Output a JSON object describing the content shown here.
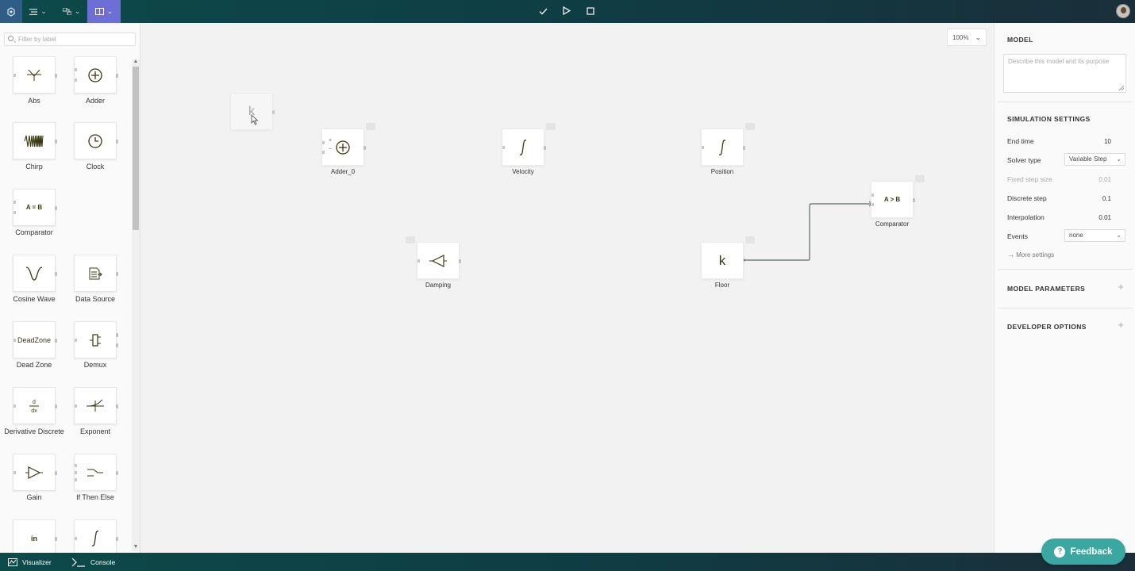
{
  "topbar": {
    "icons": [
      "logo-icon",
      "menu-icon",
      "model-icon",
      "book-icon",
      "check-icon",
      "play-icon",
      "stop-icon"
    ]
  },
  "palette": {
    "filter_placeholder": "Filter by label",
    "blocks": [
      {
        "label": "Abs",
        "glyph": "⋎"
      },
      {
        "label": "Adder",
        "glyph": "⊕"
      },
      {
        "label": "Chirp",
        "glyph": "WWW"
      },
      {
        "label": "Clock",
        "glyph": "◷"
      },
      {
        "label": "Comparator",
        "glyph": "A = B"
      },
      {
        "label": "Cosine Wave",
        "glyph": "∨"
      },
      {
        "label": "Data Source",
        "glyph": "▤"
      },
      {
        "label": "Dead Zone",
        "glyph": "DeadZone"
      },
      {
        "label": "Demux",
        "glyph": "⫷"
      },
      {
        "label": "Derivative Discrete",
        "glyph": "d/dx"
      },
      {
        "label": "Exponent",
        "glyph": "⊥"
      },
      {
        "label": "Gain",
        "glyph": "▷"
      },
      {
        "label": "If Then Else",
        "glyph": "⊶"
      },
      {
        "label": "",
        "glyph": "in"
      },
      {
        "label": "",
        "glyph": "∫"
      }
    ]
  },
  "canvas": {
    "zoom": "100%",
    "drag_glyph": "k",
    "nodes": [
      {
        "id": "adder0",
        "label": "Adder_0",
        "glyph": "⊕"
      },
      {
        "id": "velocity",
        "label": "Velocity",
        "glyph": "∫"
      },
      {
        "id": "position",
        "label": "Position",
        "glyph": "∫"
      },
      {
        "id": "comparator",
        "label": "Comparator",
        "glyph": "A > B"
      },
      {
        "id": "damping",
        "label": "Damping",
        "glyph": "◁"
      },
      {
        "id": "floor",
        "label": "Floor",
        "glyph": "k"
      }
    ],
    "adder_signs": [
      "+",
      "−"
    ]
  },
  "right_panel": {
    "model_title": "MODEL",
    "description_placeholder": "Describe this model and its purpose",
    "sim_title": "SIMULATION SETTINGS",
    "end_time_label": "End time",
    "end_time_value": "10",
    "solver_type_label": "Solver type",
    "solver_type_value": "Variable Step",
    "fixed_step_label": "Fixed step size",
    "fixed_step_value": "0.01",
    "discrete_step_label": "Discrete step",
    "discrete_step_value": "0.1",
    "interpolation_label": "Interpolation",
    "interpolation_value": "0.01",
    "events_label": "Events",
    "events_value": "none",
    "more_settings": "More settings",
    "model_params_title": "MODEL PARAMETERS",
    "dev_options_title": "DEVELOPER OPTIONS"
  },
  "bottombar": {
    "visualizer": "Visualizer",
    "console": "Console"
  },
  "feedback_label": "Feedback",
  "colors": {
    "topbar": "#0f3d44",
    "active_tab": "#6d6fd6",
    "feedback": "#3aa8a0",
    "block_glyph": "#3a3a10"
  }
}
